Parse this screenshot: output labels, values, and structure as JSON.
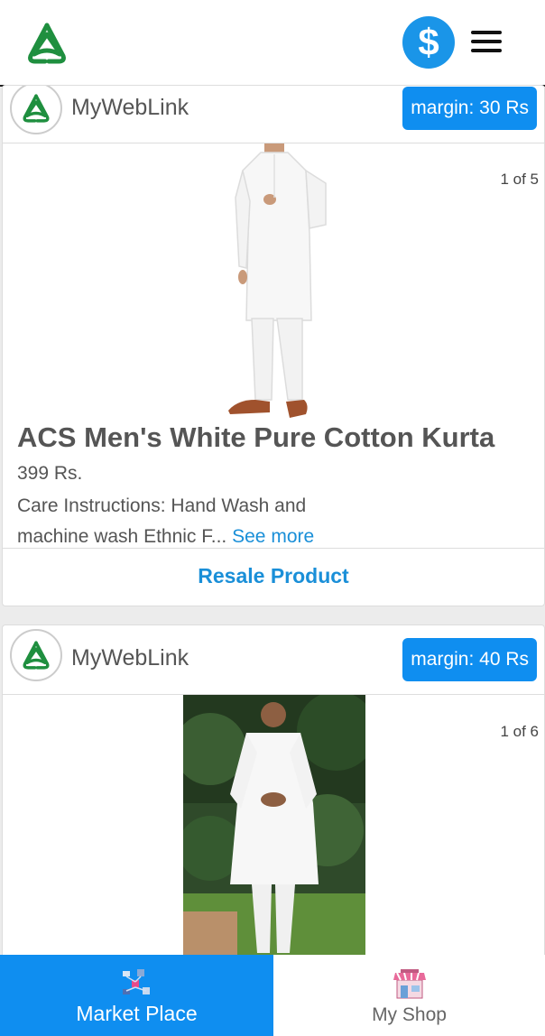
{
  "header": {
    "logo_icon": "brand-logo-icon",
    "dollar_symbol": "$",
    "menu_icon": "hamburger-menu-icon",
    "accent_color": "#1a95e8"
  },
  "products": [
    {
      "seller_name": "MyWebLink",
      "margin_label": "margin: 30 Rs",
      "slide_counter": "1 of 5",
      "title": "ACS Men's White Pure Cotton Kurta",
      "price": "399 Rs.",
      "description": "Care Instructions: Hand Wash and machine wash Ethnic F...",
      "see_more": "See more",
      "action_label": "Resale Product"
    },
    {
      "seller_name": "MyWebLink",
      "margin_label": "margin: 40 Rs",
      "slide_counter": "1 of 6"
    }
  ],
  "bottom_nav": {
    "market_place": "Market Place",
    "my_shop": "My Shop",
    "active_color": "#0f8ef0"
  }
}
